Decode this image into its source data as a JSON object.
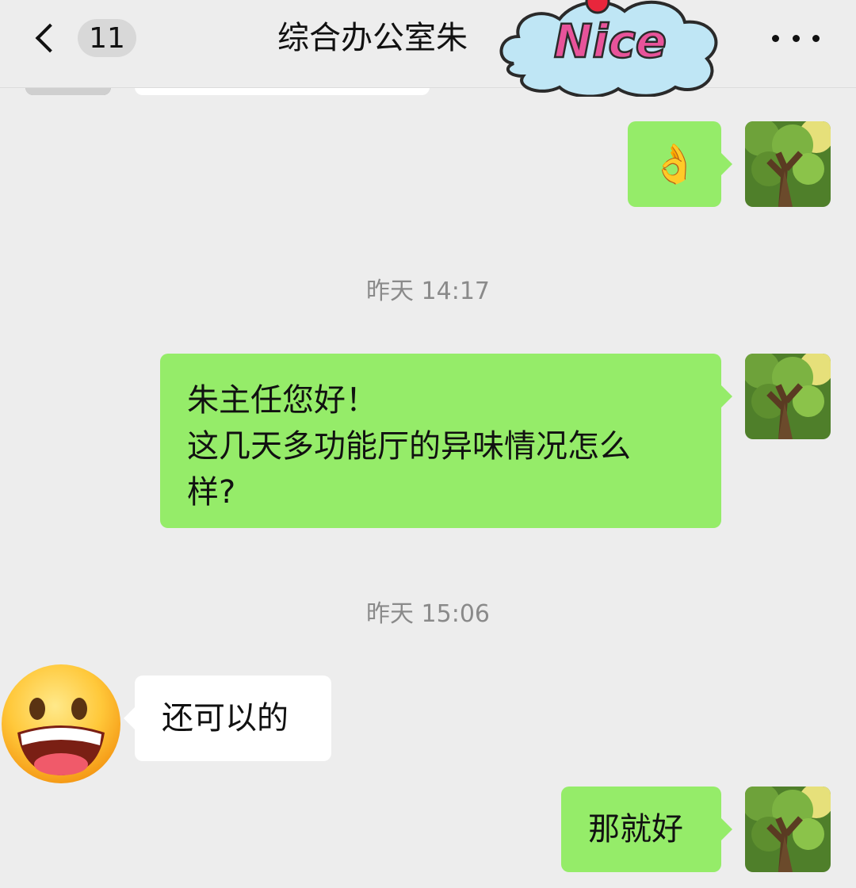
{
  "header": {
    "back_badge": "11",
    "title": "综合办公室朱",
    "sticker_text": "Nice"
  },
  "messages": {
    "ok_emoji": "👌",
    "time1": "昨天 14:17",
    "msg2": "朱主任您好！\n这几天多功能厅的异味情况怎么\n样?",
    "time2": "昨天 15:06",
    "msg3": "还可以的",
    "msg4": "那就好"
  },
  "colors": {
    "background": "#ededed",
    "outgoing_bubble": "#95ec69",
    "incoming_bubble": "#ffffff",
    "timestamp_text": "#8a8a8a"
  },
  "icons": {
    "back": "chevron-left-icon",
    "more": "more-horizontal-icon",
    "ok": "ok-hand-emoji",
    "sticker": "nice-cloud-sticker",
    "incoming_avatar": "grinning-face-emoji"
  }
}
